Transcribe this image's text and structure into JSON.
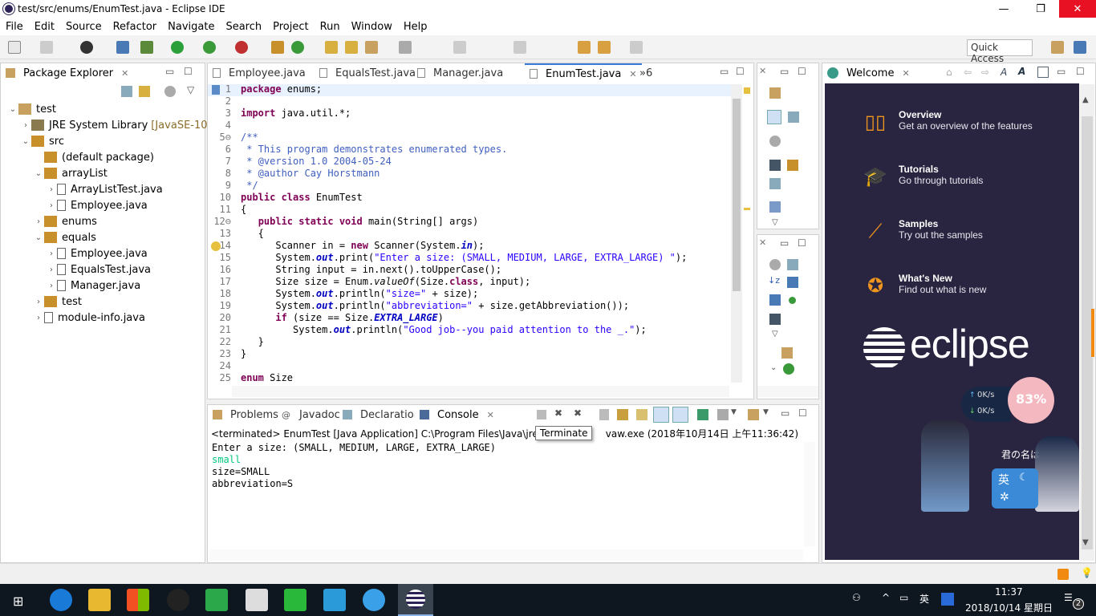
{
  "window": {
    "title": "test/src/enums/EnumTest.java - Eclipse IDE",
    "min": "—",
    "restore": "❐",
    "close": "✕"
  },
  "menu": [
    "File",
    "Edit",
    "Source",
    "Refactor",
    "Navigate",
    "Search",
    "Project",
    "Run",
    "Window",
    "Help"
  ],
  "quick_access": "Quick Access",
  "package_explorer": {
    "title": "Package Explorer",
    "items": [
      {
        "label": "test",
        "level": 0,
        "exp": "open",
        "icon": "project"
      },
      {
        "label": "JRE System Library",
        "dec": "[JavaSE-10]",
        "level": 1,
        "exp": "closed",
        "icon": "library"
      },
      {
        "label": "src",
        "level": 1,
        "exp": "open",
        "icon": "folder"
      },
      {
        "label": "(default package)",
        "level": 2,
        "exp": "",
        "icon": "package"
      },
      {
        "label": "arrayList",
        "level": 2,
        "exp": "open",
        "icon": "package"
      },
      {
        "label": "ArrayListTest.java",
        "level": 3,
        "exp": "closed",
        "icon": "java"
      },
      {
        "label": "Employee.java",
        "level": 3,
        "exp": "closed",
        "icon": "java"
      },
      {
        "label": "enums",
        "level": 2,
        "exp": "closed",
        "icon": "package"
      },
      {
        "label": "equals",
        "level": 2,
        "exp": "open",
        "icon": "package"
      },
      {
        "label": "Employee.java",
        "level": 3,
        "exp": "closed",
        "icon": "java"
      },
      {
        "label": "EqualsTest.java",
        "level": 3,
        "exp": "closed",
        "icon": "java"
      },
      {
        "label": "Manager.java",
        "level": 3,
        "exp": "closed",
        "icon": "java"
      },
      {
        "label": "test",
        "level": 2,
        "exp": "closed",
        "icon": "package"
      },
      {
        "label": "module-info.java",
        "level": 2,
        "exp": "closed",
        "icon": "java"
      }
    ]
  },
  "editor": {
    "tabs": [
      "Employee.java",
      "EqualsTest.java",
      "Manager.java",
      "EnumTest.java"
    ],
    "active_tab": 3,
    "overflow": "»6",
    "lines": [
      [
        [
          "package",
          "kw"
        ],
        [
          " enums;",
          ""
        ]
      ],
      [],
      [
        [
          "import",
          "kw"
        ],
        [
          " java.util.*;",
          ""
        ]
      ],
      [],
      [
        [
          "/**",
          "cm"
        ]
      ],
      [
        [
          " * This program demonstrates enumerated types.",
          "cm"
        ]
      ],
      [
        [
          " * @version 1.0 2004-05-24",
          "cm"
        ]
      ],
      [
        [
          " * @author Cay Horstmann",
          "cm"
        ]
      ],
      [
        [
          " */",
          "cm"
        ]
      ],
      [
        [
          "public class",
          "kw"
        ],
        [
          " EnumTest",
          ""
        ]
      ],
      [
        [
          "{",
          ""
        ]
      ],
      [
        [
          "   ",
          ""
        ],
        [
          "public static void",
          "kw"
        ],
        [
          " main(String[] args)",
          ""
        ]
      ],
      [
        [
          "   {",
          ""
        ]
      ],
      [
        [
          "      Scanner in = ",
          ""
        ],
        [
          "new",
          "kw"
        ],
        [
          " Scanner(System.",
          ""
        ],
        [
          "in",
          "fi"
        ],
        [
          ");",
          ""
        ]
      ],
      [
        [
          "      System.",
          ""
        ],
        [
          "out",
          "fi"
        ],
        [
          ".print(",
          ""
        ],
        [
          "\"Enter a size: (SMALL, MEDIUM, LARGE, EXTRA_LARGE) \"",
          "st"
        ],
        [
          ");",
          ""
        ]
      ],
      [
        [
          "      String input = in.next().toUpperCase();",
          ""
        ]
      ],
      [
        [
          "      Size size = Enum.",
          ""
        ],
        [
          "valueOf",
          "it"
        ],
        [
          "(Size.",
          ""
        ],
        [
          "class",
          "kw"
        ],
        [
          ", input);",
          ""
        ]
      ],
      [
        [
          "      System.",
          ""
        ],
        [
          "out",
          "fi"
        ],
        [
          ".println(",
          ""
        ],
        [
          "\"size=\"",
          "st"
        ],
        [
          " + size);",
          ""
        ]
      ],
      [
        [
          "      System.",
          ""
        ],
        [
          "out",
          "fi"
        ],
        [
          ".println(",
          ""
        ],
        [
          "\"abbreviation=\"",
          "st"
        ],
        [
          " + size.getAbbreviation());",
          ""
        ]
      ],
      [
        [
          "      ",
          ""
        ],
        [
          "if",
          "kw"
        ],
        [
          " (size == Size.",
          ""
        ],
        [
          "EXTRA_LARGE",
          "fi"
        ],
        [
          ")",
          ""
        ]
      ],
      [
        [
          "         System.",
          ""
        ],
        [
          "out",
          "fi"
        ],
        [
          ".println(",
          ""
        ],
        [
          "\"Good job--you paid attention to the _.\"",
          "st"
        ],
        [
          ");",
          ""
        ]
      ],
      [
        [
          "   }",
          ""
        ]
      ],
      [
        [
          "}",
          ""
        ]
      ],
      [],
      [
        [
          "enum",
          "kw"
        ],
        [
          " Size",
          ""
        ]
      ]
    ]
  },
  "console": {
    "tabs": [
      "Problems",
      "Javadoc",
      "Declaration",
      "Console"
    ],
    "active_tab": 3,
    "header": "<terminated> EnumTest [Java Application] C:\\Program Files\\Java\\jre-1",
    "header_tail": "vaw.exe (2018年10月14日 上午11:36:42)",
    "tooltip": "Terminate",
    "output": [
      {
        "text": "Enter a size: (SMALL, MEDIUM, LARGE, EXTRA_LARGE)",
        "kind": "out"
      },
      {
        "text": "small",
        "kind": "in"
      },
      {
        "text": "size=SMALL",
        "kind": "out"
      },
      {
        "text": "abbreviation=S",
        "kind": "out"
      }
    ]
  },
  "welcome": {
    "title": "Welcome",
    "items": [
      {
        "title": "Overview",
        "desc": "Get an overview of the features",
        "icon": "map-icon"
      },
      {
        "title": "Tutorials",
        "desc": "Go through tutorials",
        "icon": "graduation-cap-icon"
      },
      {
        "title": "Samples",
        "desc": "Try out the samples",
        "icon": "magic-wand-icon"
      },
      {
        "title": "What's New",
        "desc": "Find out what is new",
        "icon": "star-icon"
      }
    ],
    "logo": "eclipse"
  },
  "overlay": {
    "up_speed": "0K/s",
    "down_speed": "0K/s",
    "percent": "83%",
    "caption": "君の名は",
    "ime": "英"
  },
  "taskbar": {
    "ime": "英",
    "time": "11:37",
    "date": "2018/10/14 星期日",
    "notifications": "2"
  },
  "colors": {
    "keyword": "#7f0055",
    "comment": "#3f5fbf",
    "string": "#2a00ff",
    "welcome_bg": "#29243f",
    "welcome_accent": "#f0961e",
    "console_input": "#00c87d"
  }
}
